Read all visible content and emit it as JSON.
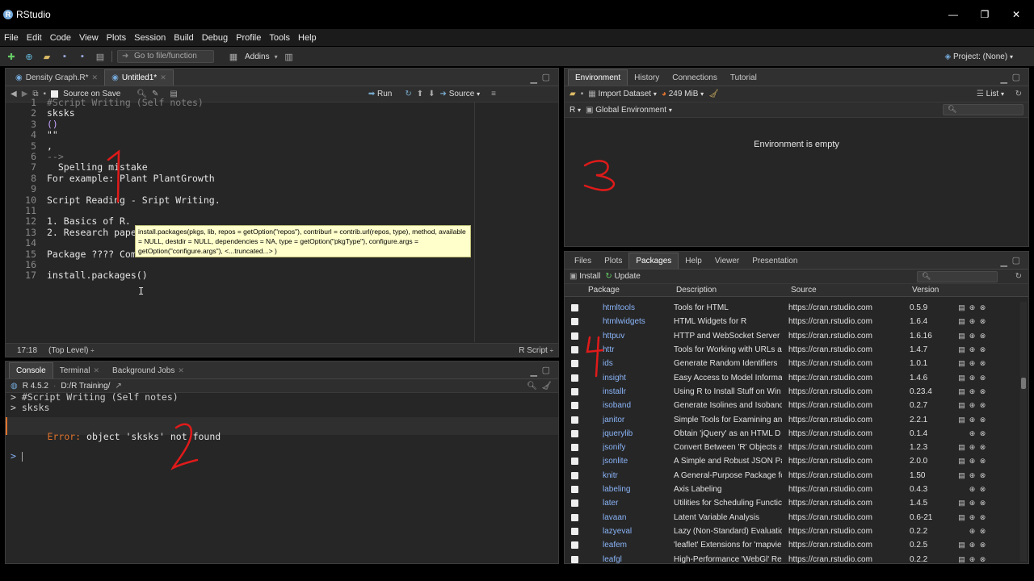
{
  "window": {
    "title": "RStudio",
    "controls": [
      "—",
      "❐",
      "✕"
    ]
  },
  "menu": [
    "File",
    "Edit",
    "Code",
    "View",
    "Plots",
    "Session",
    "Build",
    "Debug",
    "Profile",
    "Tools",
    "Help"
  ],
  "toolbar": {
    "goto_placeholder": "Go to file/function",
    "addins_label": "Addins",
    "project_label": "Project: (None)"
  },
  "editor": {
    "tabs": [
      {
        "label": "Density Graph.R*",
        "active": false
      },
      {
        "label": "Untitled1*",
        "active": true
      }
    ],
    "source_on_save": "Source on Save",
    "run_label": "Run",
    "source_label": "Source",
    "lines": [
      {
        "n": "1",
        "text": "#Script Writing (Self notes)",
        "kind": "comment"
      },
      {
        "n": "2",
        "text": "sksks",
        "kind": "plain"
      },
      {
        "n": "3",
        "text": "()",
        "kind": "paren"
      },
      {
        "n": "4",
        "text": "\"\"",
        "kind": "plain"
      },
      {
        "n": "5",
        "text": ",",
        "kind": "plain"
      },
      {
        "n": "6",
        "text": "-->",
        "kind": "comment"
      },
      {
        "n": "7",
        "text": "  Spelling mistake",
        "kind": "plain"
      },
      {
        "n": "8",
        "text": "For example: Plant PlantGrowth",
        "kind": "plain"
      },
      {
        "n": "9",
        "text": "",
        "kind": "plain"
      },
      {
        "n": "10",
        "text": "Script Reading - Sript Writing.",
        "kind": "plain"
      },
      {
        "n": "11",
        "text": "",
        "kind": "plain"
      },
      {
        "n": "12",
        "text": "1. Basics of R.",
        "kind": "plain"
      },
      {
        "n": "13",
        "text": "2. Research paper",
        "kind": "plain"
      },
      {
        "n": "14",
        "text": "",
        "kind": "plain"
      },
      {
        "n": "15",
        "text": "Package ???? Comm",
        "kind": "plain"
      },
      {
        "n": "16",
        "text": "",
        "kind": "plain"
      },
      {
        "n": "17",
        "text": "install.packages()",
        "kind": "plain"
      }
    ],
    "tooltip": "install.packages(pkgs, lib, repos = getOption(\"repos\"), contriburl = contrib.url(repos, type), method, available = NULL, destdir = NULL, dependencies = NA, type = getOption(\"pkgType\"), configure.args = getOption(\"configure.args\"), <...truncated...> )",
    "status_position": "17:18",
    "status_scope": "(Top Level)",
    "status_type": "R Script"
  },
  "console": {
    "tabs": [
      {
        "label": "Console",
        "active": true
      },
      {
        "label": "Terminal",
        "active": false
      },
      {
        "label": "Background Jobs",
        "active": false
      }
    ],
    "r_version": "R 4.5.2",
    "path": "D:/R Training/",
    "lines": [
      "> #Script Writing (Self notes)",
      "> sksks"
    ],
    "error_label": "Error:",
    "error_text": " object 'sksks' not found",
    "prompt": ">"
  },
  "environment": {
    "tabs": [
      {
        "label": "Environment",
        "active": true
      },
      {
        "label": "History",
        "active": false
      },
      {
        "label": "Connections",
        "active": false
      },
      {
        "label": "Tutorial",
        "active": false
      }
    ],
    "import_label": "Import Dataset",
    "memory_label": "249 MiB",
    "list_label": "List",
    "lang_label": "R",
    "scope_label": "Global Environment",
    "empty_message": "Environment is empty"
  },
  "packages": {
    "tabs": [
      {
        "label": "Files",
        "active": false
      },
      {
        "label": "Plots",
        "active": false
      },
      {
        "label": "Packages",
        "active": true
      },
      {
        "label": "Help",
        "active": false
      },
      {
        "label": "Viewer",
        "active": false
      },
      {
        "label": "Presentation",
        "active": false
      }
    ],
    "install_label": "Install",
    "update_label": "Update",
    "columns": [
      "Package",
      "Description",
      "Source",
      "Version"
    ],
    "rows": [
      {
        "name": "htmltools",
        "desc": "Tools for HTML",
        "src": "https://cran.rstudio.com",
        "ver": "0.5.9",
        "doc": true
      },
      {
        "name": "htmlwidgets",
        "desc": "HTML Widgets for R",
        "src": "https://cran.rstudio.com",
        "ver": "1.6.4",
        "doc": true
      },
      {
        "name": "httpuv",
        "desc": "HTTP and WebSocket Server L",
        "src": "https://cran.rstudio.com",
        "ver": "1.6.16",
        "doc": true
      },
      {
        "name": "httr",
        "desc": "Tools for Working with URLs a",
        "src": "https://cran.rstudio.com",
        "ver": "1.4.7",
        "doc": true
      },
      {
        "name": "ids",
        "desc": "Generate Random Identifiers",
        "src": "https://cran.rstudio.com",
        "ver": "1.0.1",
        "doc": true
      },
      {
        "name": "insight",
        "desc": "Easy Access to Model Informa",
        "src": "https://cran.rstudio.com",
        "ver": "1.4.6",
        "doc": true
      },
      {
        "name": "installr",
        "desc": "Using R to Install Stuff on Win",
        "src": "https://cran.rstudio.com",
        "ver": "0.23.4",
        "doc": true
      },
      {
        "name": "isoband",
        "desc": "Generate Isolines and Isobanc",
        "src": "https://cran.rstudio.com",
        "ver": "0.2.7",
        "doc": true
      },
      {
        "name": "janitor",
        "desc": "Simple Tools for Examining an",
        "src": "https://cran.rstudio.com",
        "ver": "2.2.1",
        "doc": true
      },
      {
        "name": "jquerylib",
        "desc": "Obtain 'jQuery' as an HTML D",
        "src": "https://cran.rstudio.com",
        "ver": "0.1.4",
        "doc": false
      },
      {
        "name": "jsonify",
        "desc": "Convert Between 'R' Objects a",
        "src": "https://cran.rstudio.com",
        "ver": "1.2.3",
        "doc": true
      },
      {
        "name": "jsonlite",
        "desc": "A Simple and Robust JSON Pa",
        "src": "https://cran.rstudio.com",
        "ver": "2.0.0",
        "doc": true
      },
      {
        "name": "knitr",
        "desc": "A General-Purpose Package fc",
        "src": "https://cran.rstudio.com",
        "ver": "1.50",
        "doc": true
      },
      {
        "name": "labeling",
        "desc": "Axis Labeling",
        "src": "https://cran.rstudio.com",
        "ver": "0.4.3",
        "doc": false
      },
      {
        "name": "later",
        "desc": "Utilities for Scheduling Functic",
        "src": "https://cran.rstudio.com",
        "ver": "1.4.5",
        "doc": true
      },
      {
        "name": "lavaan",
        "desc": "Latent Variable Analysis",
        "src": "https://cran.rstudio.com",
        "ver": "0.6-21",
        "doc": true
      },
      {
        "name": "lazyeval",
        "desc": "Lazy (Non-Standard) Evaluatic",
        "src": "https://cran.rstudio.com",
        "ver": "0.2.2",
        "doc": false
      },
      {
        "name": "leafem",
        "desc": "'leaflet' Extensions for 'mapvie",
        "src": "https://cran.rstudio.com",
        "ver": "0.2.5",
        "doc": true
      },
      {
        "name": "leafgl",
        "desc": "High-Performance 'WebGl' Re",
        "src": "https://cran.rstudio.com",
        "ver": "0.2.2",
        "doc": true
      }
    ]
  },
  "annotations": [
    "1",
    "2",
    "3",
    "4"
  ],
  "colors": {
    "accent": "#75aadb",
    "error": "#e0742e",
    "annotation": "#e01a1a",
    "package_link": "#8ab4f8"
  }
}
